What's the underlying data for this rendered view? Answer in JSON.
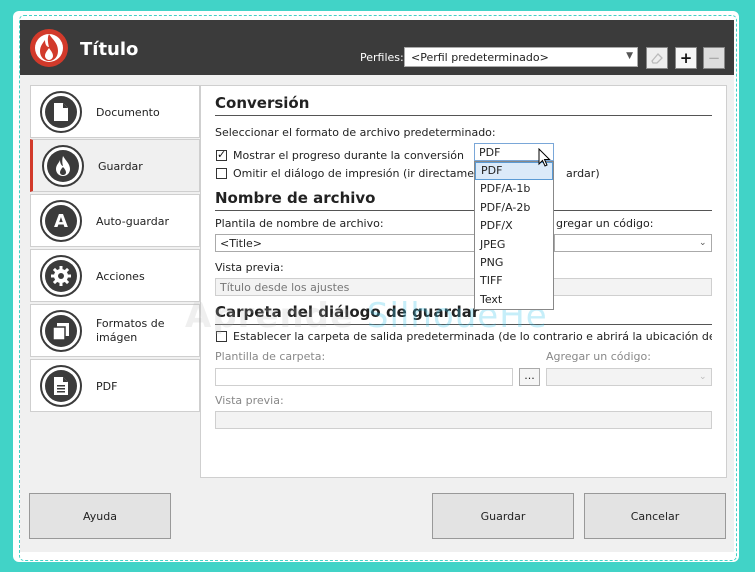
{
  "window": {
    "title": "Título"
  },
  "profiles": {
    "label": "Perfiles:",
    "selected": "<Perfil predeterminado>"
  },
  "sidebar": {
    "items": [
      {
        "label": "Documento",
        "icon": "document-icon"
      },
      {
        "label": "Guardar",
        "icon": "flame-icon"
      },
      {
        "label": "Auto-guardar",
        "icon": "letter-a-icon"
      },
      {
        "label": "Acciones",
        "icon": "gear-icon"
      },
      {
        "label": "Formatos de imágen",
        "icon": "copy-pages-icon"
      },
      {
        "label": "PDF",
        "icon": "pdf-file-icon"
      }
    ],
    "active_index": 1
  },
  "conversion": {
    "heading": "Conversión",
    "format_label": "Seleccionar el formato de archivo predeterminado:",
    "format_selected": "PDF",
    "format_options": [
      "PDF",
      "PDF/A-1b",
      "PDF/A-2b",
      "PDF/X",
      "JPEG",
      "PNG",
      "TIFF",
      "Text"
    ],
    "show_progress": {
      "label": "Mostrar el progreso durante la conversión",
      "checked": true
    },
    "skip_print": {
      "label": "Omitir el diálogo de impresión (ir directamente",
      "label_tail": "ardar)",
      "checked": false
    }
  },
  "filename": {
    "heading": "Nombre de archivo",
    "template_label": "Plantila de nombre de archivo:",
    "add_code_label": "gregar un código:",
    "template_value": "<Title>",
    "preview_label": "Vista previa:",
    "preview_value": "Título desde los ajustes"
  },
  "save_dialog": {
    "heading": "Carpeta del diálogo de guardar",
    "set_folder": {
      "label": "Establecer la carpeta de salida predeterminada (de lo contrario e abrirá la ubicación del último a",
      "checked": false
    },
    "folder_label": "Plantilla de carpeta:",
    "browse_label": "...",
    "add_code_label": "Agregar un código:",
    "preview_label": "Vista previa:"
  },
  "watermark": {
    "part1": "Aprende ",
    "part2": "SilhoueHe"
  },
  "footer": {
    "help": "Ayuda",
    "save": "Guardar",
    "cancel": "Cancelar"
  },
  "colors": {
    "titlebar": "#3b3b3b",
    "accent": "#d23a2b",
    "frame": "#41d3c7"
  }
}
